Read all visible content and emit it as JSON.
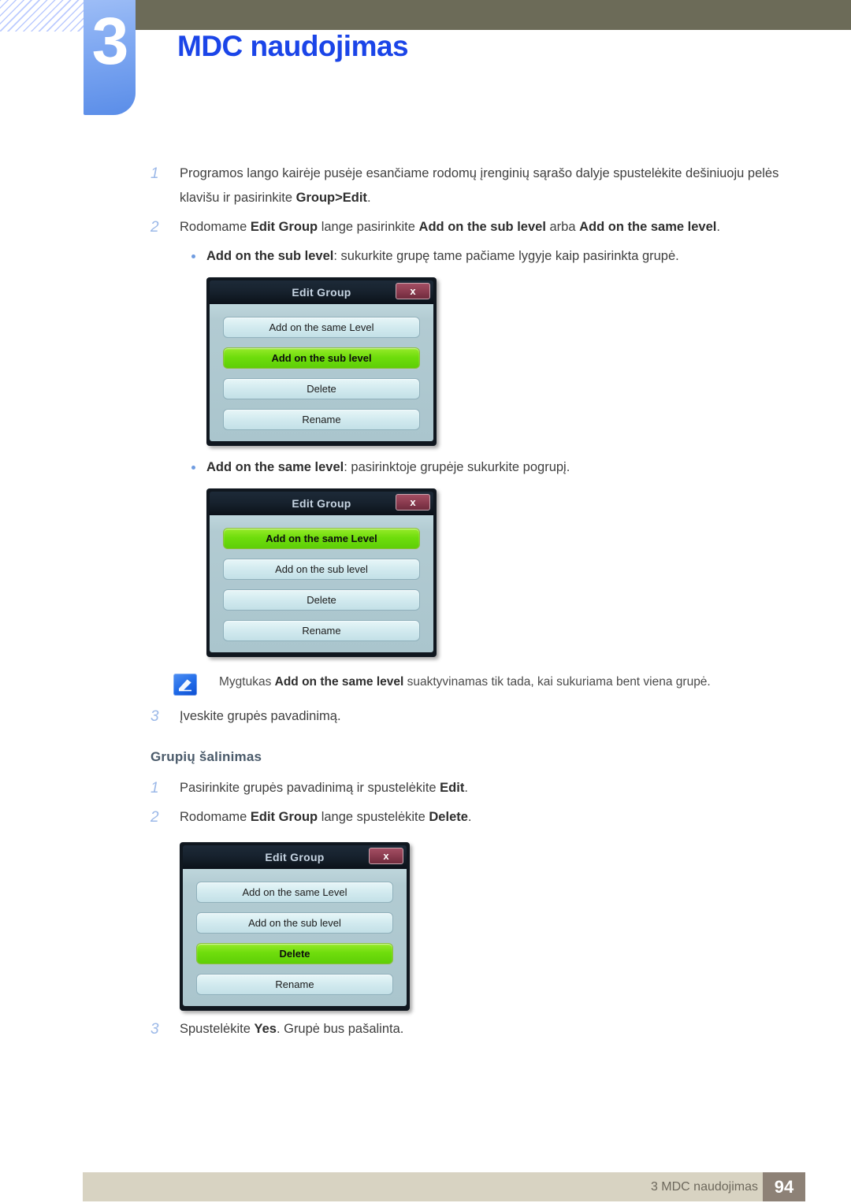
{
  "header": {
    "chapter_number": "3",
    "chapter_title": "MDC naudojimas"
  },
  "content": {
    "step1_num": "1",
    "step1_text_a": "Programos lango kairėje pusėje esančiame rodomų įrenginių sąrašo dalyje spustelėkite dešiniuoju pelės klavišu ir pasirinkite ",
    "step1_bold": "Group>Edit",
    "step1_text_b": ".",
    "step2_num": "2",
    "step2_text_a": "Rodomame ",
    "step2_bold_a": "Edit Group",
    "step2_text_b": " lange pasirinkite ",
    "step2_bold_b": "Add on the sub level",
    "step2_text_c": " arba ",
    "step2_bold_c": "Add on the same level",
    "step2_text_d": ".",
    "bullet1_bold": "Add on the sub level",
    "bullet1_text": ": sukurkite grupę tame pačiame lygyje kaip pasirinkta grupė.",
    "bullet2_bold": "Add on the same level",
    "bullet2_text": ": pasirinktoje grupėje sukurkite pogrupį.",
    "note_text_a": "Mygtukas ",
    "note_bold": "Add on the same level",
    "note_text_b": " suaktyvinamas tik tada, kai sukuriama bent viena grupė.",
    "note_icon": "note-pencil-icon",
    "step3_num": "3",
    "step3_text": "Įveskite grupės pavadinimą.",
    "section_heading": "Grupių šalinimas",
    "del_step1_num": "1",
    "del_step1_text_a": "Pasirinkite grupės pavadinimą ir spustelėkite ",
    "del_step1_bold": "Edit",
    "del_step1_text_b": ".",
    "del_step2_num": "2",
    "del_step2_text_a": "Rodomame ",
    "del_step2_bold_a": "Edit Group",
    "del_step2_text_b": " lange spustelėkite ",
    "del_step2_bold_b": "Delete",
    "del_step2_text_c": ".",
    "del_step3_num": "3",
    "del_step3_text_a": "Spustelėkite ",
    "del_step3_bold": "Yes",
    "del_step3_text_b": ". Grupė bus pašalinta."
  },
  "dialogs": [
    {
      "title": "Edit Group",
      "close_label": "x",
      "buttons": [
        {
          "label": "Add on the same Level",
          "highlighted": false
        },
        {
          "label": "Add on the sub level",
          "highlighted": true
        },
        {
          "label": "Delete",
          "highlighted": false
        },
        {
          "label": "Rename",
          "highlighted": false
        }
      ]
    },
    {
      "title": "Edit Group",
      "close_label": "x",
      "buttons": [
        {
          "label": "Add on the same Level",
          "highlighted": true
        },
        {
          "label": "Add on the sub level",
          "highlighted": false
        },
        {
          "label": "Delete",
          "highlighted": false
        },
        {
          "label": "Rename",
          "highlighted": false
        }
      ]
    },
    {
      "title": "Edit Group",
      "close_label": "x",
      "buttons": [
        {
          "label": "Add on the same Level",
          "highlighted": false
        },
        {
          "label": "Add on the sub level",
          "highlighted": false
        },
        {
          "label": "Delete",
          "highlighted": true
        },
        {
          "label": "Rename",
          "highlighted": false
        }
      ]
    }
  ],
  "footer": {
    "label": "3 MDC naudojimas",
    "page": "94"
  },
  "colors": {
    "chapter_title": "#1b45e8",
    "badge": "#80a9f2",
    "olive_bar": "#6c6b58",
    "footer_bar": "#d8d3c2",
    "footer_page_box": "#8d8176",
    "dialog_highlight": "#6fdd0c",
    "dialog_body": "#b2cbd2",
    "dialog_close": "#8c3c50"
  }
}
